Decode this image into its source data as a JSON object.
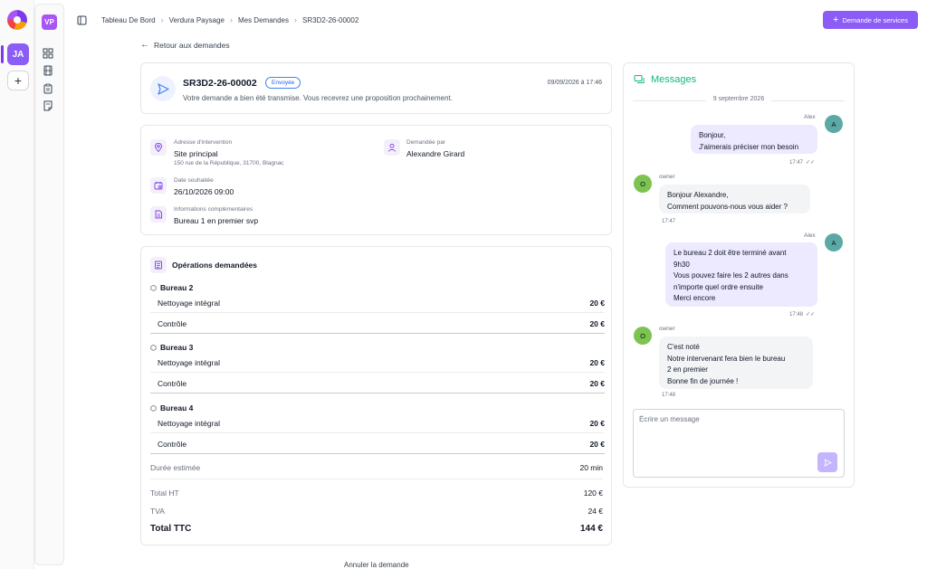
{
  "sidebar": {
    "workspace_initials": "JA",
    "add_label": "+",
    "org_initials": "VP",
    "nav_icons": [
      "dashboard-icon",
      "film-icon",
      "clipboard-icon",
      "note-icon"
    ]
  },
  "breadcrumb": [
    "Tableau De Bord",
    "Verdura Paysage",
    "Mes Demandes",
    "SR3D2-26-00002"
  ],
  "header": {
    "new_request_button": "Demande de services"
  },
  "back_link": "Retour aux demandes",
  "request": {
    "ref": "SR3D2-26-00002",
    "status": "Envoyée",
    "date": "09/09/2026 à 17:46",
    "message": "Votre demande a bien été transmise. Vous recevrez une proposition prochainement."
  },
  "info": {
    "address_label": "Adresse d'intervention",
    "address_value": "Site principal",
    "address_sub": "150 rue de la République, 31700, Blagnac",
    "requested_by_label": "Demandée par",
    "requested_by_value": "Alexandre Girard",
    "date_label": "Date souhaitée",
    "date_value": "26/10/2026 09:00",
    "extra_label": "Informations complémentaires",
    "extra_value": "Bureau 1 en premier svp"
  },
  "operations": {
    "title": "Opérations demandées",
    "groups": [
      {
        "name": "Bureau 2",
        "items": [
          {
            "name": "Nettoyage intégral",
            "price": "20 €"
          },
          {
            "name": "Contrôle",
            "price": "20 €"
          }
        ]
      },
      {
        "name": "Bureau 3",
        "items": [
          {
            "name": "Nettoyage intégral",
            "price": "20 €"
          },
          {
            "name": "Contrôle",
            "price": "20 €"
          }
        ]
      },
      {
        "name": "Bureau 4",
        "items": [
          {
            "name": "Nettoyage intégral",
            "price": "20 €"
          },
          {
            "name": "Contrôle",
            "price": "20 €"
          }
        ]
      }
    ],
    "duration_label": "Durée estimée",
    "duration_value": "20 min",
    "total_ht_label": "Total HT",
    "total_ht_value": "120 €",
    "tva_label": "TVA",
    "tva_value": "24 €",
    "total_ttc_label": "Total TTC",
    "total_ttc_value": "144 €"
  },
  "cancel_link": "Annuler la demande",
  "messages": {
    "title": "Messages",
    "day": "9 septembre 2026",
    "list": [
      {
        "author": "Alex",
        "initial": "A",
        "lines": [
          "Bonjour,",
          "J'aimerais préciser mon besoin"
        ],
        "time": "17:47"
      },
      {
        "author": "owner",
        "initial": "O",
        "lines": [
          "Bonjour Alexandre,",
          "Comment pouvons-nous vous aider ?"
        ],
        "time": "17:47"
      },
      {
        "author": "Alex",
        "initial": "A",
        "lines": [
          "Le bureau 2 doit être terminé avant",
          "9h30",
          "Vous pouvez faire les 2 autres dans",
          "n'importe quel ordre ensuite",
          "Merci encore"
        ],
        "time": "17:48"
      },
      {
        "author": "owner",
        "initial": "O",
        "lines": [
          "C'est noté",
          "Notre intervenant fera bien le bureau",
          "2 en premier",
          "Bonne fin de journée !"
        ],
        "time": "17:48"
      }
    ],
    "compose_placeholder": "Écrire un message"
  }
}
